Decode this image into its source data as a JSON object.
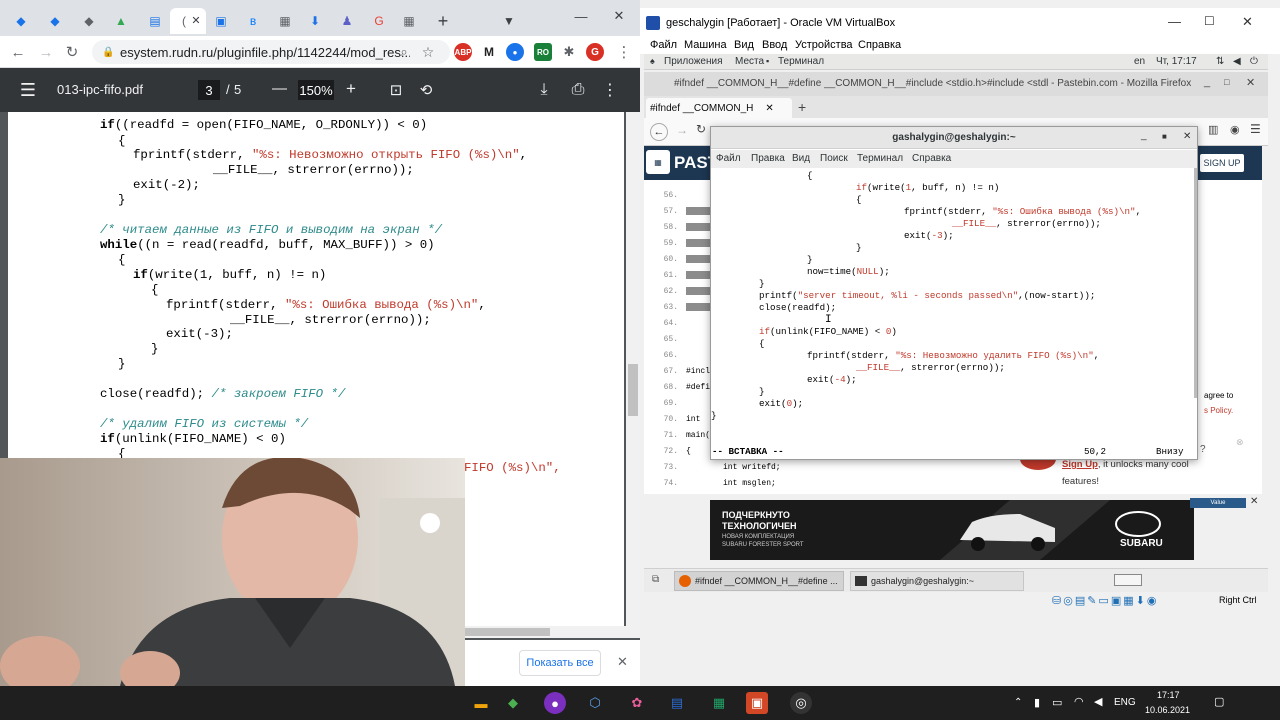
{
  "chrome": {
    "new_tab_symbol": "+",
    "url": "esystem.rudn.ru/pluginfile.php/1142244/mod_res...",
    "profile_initial": "G",
    "ext_abp": "ABP",
    "ext_ro": "RO"
  },
  "pdf": {
    "file_name": "013-ipc-fifo.pdf",
    "page_current": "3",
    "page_sep": "/",
    "page_total": "5",
    "zoom": "150%",
    "zoom_minus": "—",
    "zoom_plus": "+",
    "code_lines": [
      "if((readfd = open(FIFO_NAME, O_RDONLY)) < 0)",
      "{",
      "fprintf(stderr, \"%s: Невозможно открыть FIFO (%s)\\n\",",
      "__FILE__, strerror(errno));",
      "exit(-2);",
      "}",
      "/* читаем данные из FIFO и выводим на экран */",
      "while((n = read(readfd, buff, MAX_BUFF)) > 0)",
      "{",
      "if(write(1, buff, n) != n)",
      "{",
      "fprintf(stderr, \"%s: Ошибка вывода (%s)\\n\",",
      "__FILE__, strerror(errno));",
      "exit(-3);",
      "}",
      "}",
      "close(readfd); /* закроем FIFO */",
      "/* удалим FIFO из системы */",
      "if(unlink(FIFO_NAME) < 0)",
      "{",
      "FIFO (%s)\\n\","
    ],
    "show_all": "Показать все"
  },
  "vbox": {
    "title": "geschalygin [Работает] - Oracle VM VirtualBox",
    "menu": [
      "Файл",
      "Машина",
      "Вид",
      "Ввод",
      "Устройства",
      "Справка"
    ],
    "gnome_top": {
      "apps": "Приложения",
      "places": "Места",
      "terminal": "Терминал",
      "lang": "en",
      "clock": "Чт, 17:17"
    },
    "firefox": {
      "title": "#ifndef __COMMON_H__#define __COMMON_H__#include <stdio.h>#include <stdl - Pastebin.com - Mozilla Firefox",
      "tab": "#ifndef __COMMON_H",
      "logo": "PAST",
      "signup_btn": "SIGN UP"
    },
    "pastebin": {
      "line_numbers": [
        "56.",
        "57.",
        "58.",
        "59.",
        "60.",
        "61.",
        "62.",
        "63.",
        "64.",
        "65.",
        "66.",
        "67.",
        "68.",
        "69.",
        "70.",
        "71.",
        "72.",
        "73.",
        "74."
      ],
      "code": [
        "#inclu",
        "#defin",
        "int",
        "main(",
        "{",
        "int writefd;",
        "int msglen;"
      ],
      "popup_line1": "agree to",
      "popup_line2": "s Policy.",
      "signup_link": "Sign Up",
      "signup_rest": ", it unlocks many cool",
      "signup_rest2": "features!",
      "ad_line1": "ПОДЧЕРКНУТО",
      "ad_line2": "ТЕХНОЛОГИЧЕН",
      "ad_line3": "НОВАЯ КОМПЛЕКТАЦИЯ",
      "ad_line4": "SUBARU FORESTER SPORT",
      "ad_brand": "SUBARU",
      "ad_small": "Value"
    },
    "terminal": {
      "title": "gashalygin@geshalygin:~",
      "menu": [
        "Файл",
        "Правка",
        "Вид",
        "Поиск",
        "Терминал",
        "Справка"
      ],
      "lines": [
        "{",
        "if(write(1, buff, n) != n)",
        "{",
        "fprintf(stderr, \"%s: Ошибка вывода (%s)\\n\",",
        "__FILE__, strerror(errno));",
        "exit(-3);",
        "}",
        "}",
        "now=time(NULL);",
        "}",
        "printf(\"server timeout, %li - seconds passed\\n\",(now-start));",
        "close(readfd);",
        "",
        "if(unlink(FIFO_NAME) < 0)",
        "{",
        "fprintf(stderr, \"%s: Невозможно удалить FIFO (%s)\\n\",",
        "__FILE__, strerror(errno));",
        "exit(-4);",
        "}",
        "exit(0);",
        "}"
      ],
      "mode": "-- ВСТАВКА --",
      "position": "50,2",
      "scroll": "Внизу"
    },
    "gnome_bottom": {
      "task1": "#ifndef __COMMON_H__#define ...",
      "task2": "gashalygin@geshalygin:~"
    },
    "status_host_key": "Right Ctrl"
  },
  "taskbar": {
    "lang": "ENG",
    "time": "17:17",
    "date": "10.06.2021"
  }
}
